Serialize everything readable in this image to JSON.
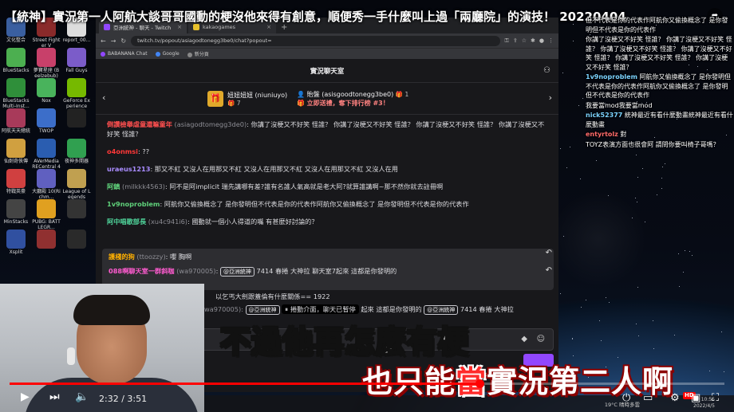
{
  "video": {
    "title": "【統神】實況第一人阿航大談哥哥國動的梗沒他來得有創意，順便秀一手什麼叫上過「兩廳院」的演技！ 20220404",
    "current_time": "2:32",
    "separator": "/",
    "duration": "3:51",
    "progress_fraction": 0.657,
    "subtitle_line1": "不過他再怎麼有梗",
    "subtitle_line2_a": "也只能",
    "subtitle_line2_b": "當",
    "subtitle_line2_c": "實況第二人啊",
    "hd_badge": "HD"
  },
  "desktop_icons": [
    {
      "label": "文化整合",
      "color": "#3a5fa0"
    },
    {
      "label": "Street Fighter V",
      "color": "#8a2a2a"
    },
    {
      "label": "report_00...",
      "color": "#dddddd"
    },
    {
      "label": "BlueStacks",
      "color": "#4caf50"
    },
    {
      "label": "夢寶星座 (Beelzebub)",
      "color": "#c8406a"
    },
    {
      "label": "Fall Guys",
      "color": "#7b5cc9"
    },
    {
      "label": "BlueStacks Multi-Inst...",
      "color": "#2f8f3a"
    },
    {
      "label": "Nox",
      "color": "#49b35c"
    },
    {
      "label": "GeForce Experience",
      "color": "#76b900"
    },
    {
      "label": "阿航天天總統",
      "color": "#a83a5a"
    },
    {
      "label": "TWOP",
      "color": "#3c6ec9"
    },
    {
      "label": "",
      "color": "#222222"
    },
    {
      "label": "仙劍奇俠傳",
      "color": "#d0a040"
    },
    {
      "label": "AVerMedia RECentral 4",
      "color": "#2a5db0"
    },
    {
      "label": "夜神多開器",
      "color": "#30a050"
    },
    {
      "label": "特戰英豪",
      "color": "#d04040"
    },
    {
      "label": "大廳殿 10(Richm...",
      "color": "#6060c0"
    },
    {
      "label": "League of Legends",
      "color": "#c0a050"
    },
    {
      "label": "MinStacks",
      "color": "#444444"
    },
    {
      "label": "PUBG: BATTLEGR...",
      "color": "#e0a020"
    },
    {
      "label": "",
      "color": "#333333"
    },
    {
      "label": "Xsplit",
      "color": "#3050a0"
    },
    {
      "label": "",
      "color": "#903030"
    },
    {
      "label": "",
      "color": "#2a2a2a"
    }
  ],
  "browser": {
    "tabs": [
      {
        "label": "亞洲統神 - 聊天 - Twitch",
        "close": "×"
      },
      {
        "label": "kakaogames",
        "close": "×"
      }
    ],
    "new_tab": "+",
    "nav_back": "←",
    "nav_forward": "→",
    "nav_reload": "↻",
    "url": "twitch.tv/popout/asiagodtonegg3be0/chat?popout=",
    "bookmarks": [
      "BABANANA Chat",
      "Google",
      "新分頁"
    ],
    "bookmark_colors": [
      "#9147ff",
      "#4285f4",
      "#888888"
    ]
  },
  "chat": {
    "header_title": "實況聊天室",
    "users_icon": "users-icon",
    "leaderboard": {
      "gifter_name": "妞妞妞妞 (niuniuyo)",
      "gifter_count": "7",
      "top_name": "貽盤 (asisgoodtonegg3be0)",
      "top_count": "1",
      "cta": "立即送禮，奪下排行榜 #3！"
    },
    "messages": [
      {
        "name": "倒讚檢舉虐童還嘛童年",
        "handle": "(asiagodtomegg3de0)",
        "text": ": 你講了沒梗又不好笑 怪誰？ 你講了沒梗又不好笑 怪誰？ 你講了沒梗又不好笑 怪誰？ 你講了沒梗又不好笑 怪誰？",
        "color": "#ff4f4f"
      },
      {
        "name": "o4onmsi",
        "handle": "",
        "text": ": ??",
        "color": "#ff3838"
      },
      {
        "name": "uraeus1213",
        "handle": "",
        "text": ": 那又不紅 又沒人在用那又不紅 又沒人在用那又不紅 又沒人在用那又不紅 又沒人在用",
        "color": "#a98cff"
      },
      {
        "name": "阿鎮",
        "handle": "(milkkk4563)",
        "text": ": 阿不是阿implicit 瑞先講哪有差?誰有名誰人氣高就是老大阿?就算誰講啊~那不然你就去註冊啊",
        "color": "#5fd07a"
      },
      {
        "name": "1v9noproblem",
        "handle": "",
        "text": ": 阿航你又偷換概念了 是你發明但不代表是你的代表作阿航你又偷換概念了 是你發明但不代表是你的代表作",
        "color": "#5fd07a"
      },
      {
        "name": "阿中唱歌部長",
        "handle": "(xu4c941i6)",
        "text": ": 國動就一個小人得道的嘴 有甚麼好討論的？",
        "color": "#4fd39a"
      }
    ],
    "pinned": [
      {
        "name": "護棧的狗",
        "handle": "(ttoozzy)",
        "text": ": 嚶 胸啊",
        "color": "#ffb000"
      },
      {
        "name": "088啊聊天室一群斜咖",
        "handle": "(wa970005)",
        "badge": "@亞洲統神",
        "text": "7414 春捲 大神拉 聊天室7起來 這都是你發明的",
        "color": "#ff5bd0"
      }
    ],
    "partial_line1": "以乞丐大劍跟蓋倫有什麼關係== 1922",
    "partial_line2_handle": "wa970005):",
    "partial_line2_badge1": "@亞洲統神",
    "partial_line2_paused": "捲動介面，聊天已暫停",
    "partial_line2_text": "起來 這都是你發明的",
    "partial_line2_badge2": "@亞洲統神",
    "partial_line2_tail": "7414 春捲 大神拉"
  },
  "side_chat": [
    {
      "name": "",
      "text": "但不代表是你的代表作阿航你又偷換概念了 是你發明但不代表是你的代表作"
    },
    {
      "name": "",
      "text": "你講了沒梗又不好笑 怪誰？ 你講了沒梗又不好笑 怪誰？ 你講了沒梗又不好笑 怪誰？ 你講了沒梗又不好笑 怪誰？ 你講了沒梗又不好笑 怪誰？ 你講了沒梗又不好笑 怪誰？"
    },
    {
      "name": "1v9noproblem",
      "text": "阿航你又偷換概念了 是你發明但不代表是你的代表作阿航你又偷換概念了 是你發明但不代表是你的代表作"
    },
    {
      "name": "",
      "text": "我要當mod我要當mod"
    },
    {
      "name": "nick52377",
      "text": "統神最近有看什麼動畫統神最近有看什麼動畫"
    },
    {
      "name": "entyrtolz",
      "text": "對"
    },
    {
      "name": "",
      "text": "TOYZ表演方面也很會阿 請問你要叫椅子哥嗎？"
    }
  ],
  "taskbar": {
    "weather": "19°C 晴時多雲",
    "time": "下午 10:55",
    "date": "2022/4/5"
  }
}
